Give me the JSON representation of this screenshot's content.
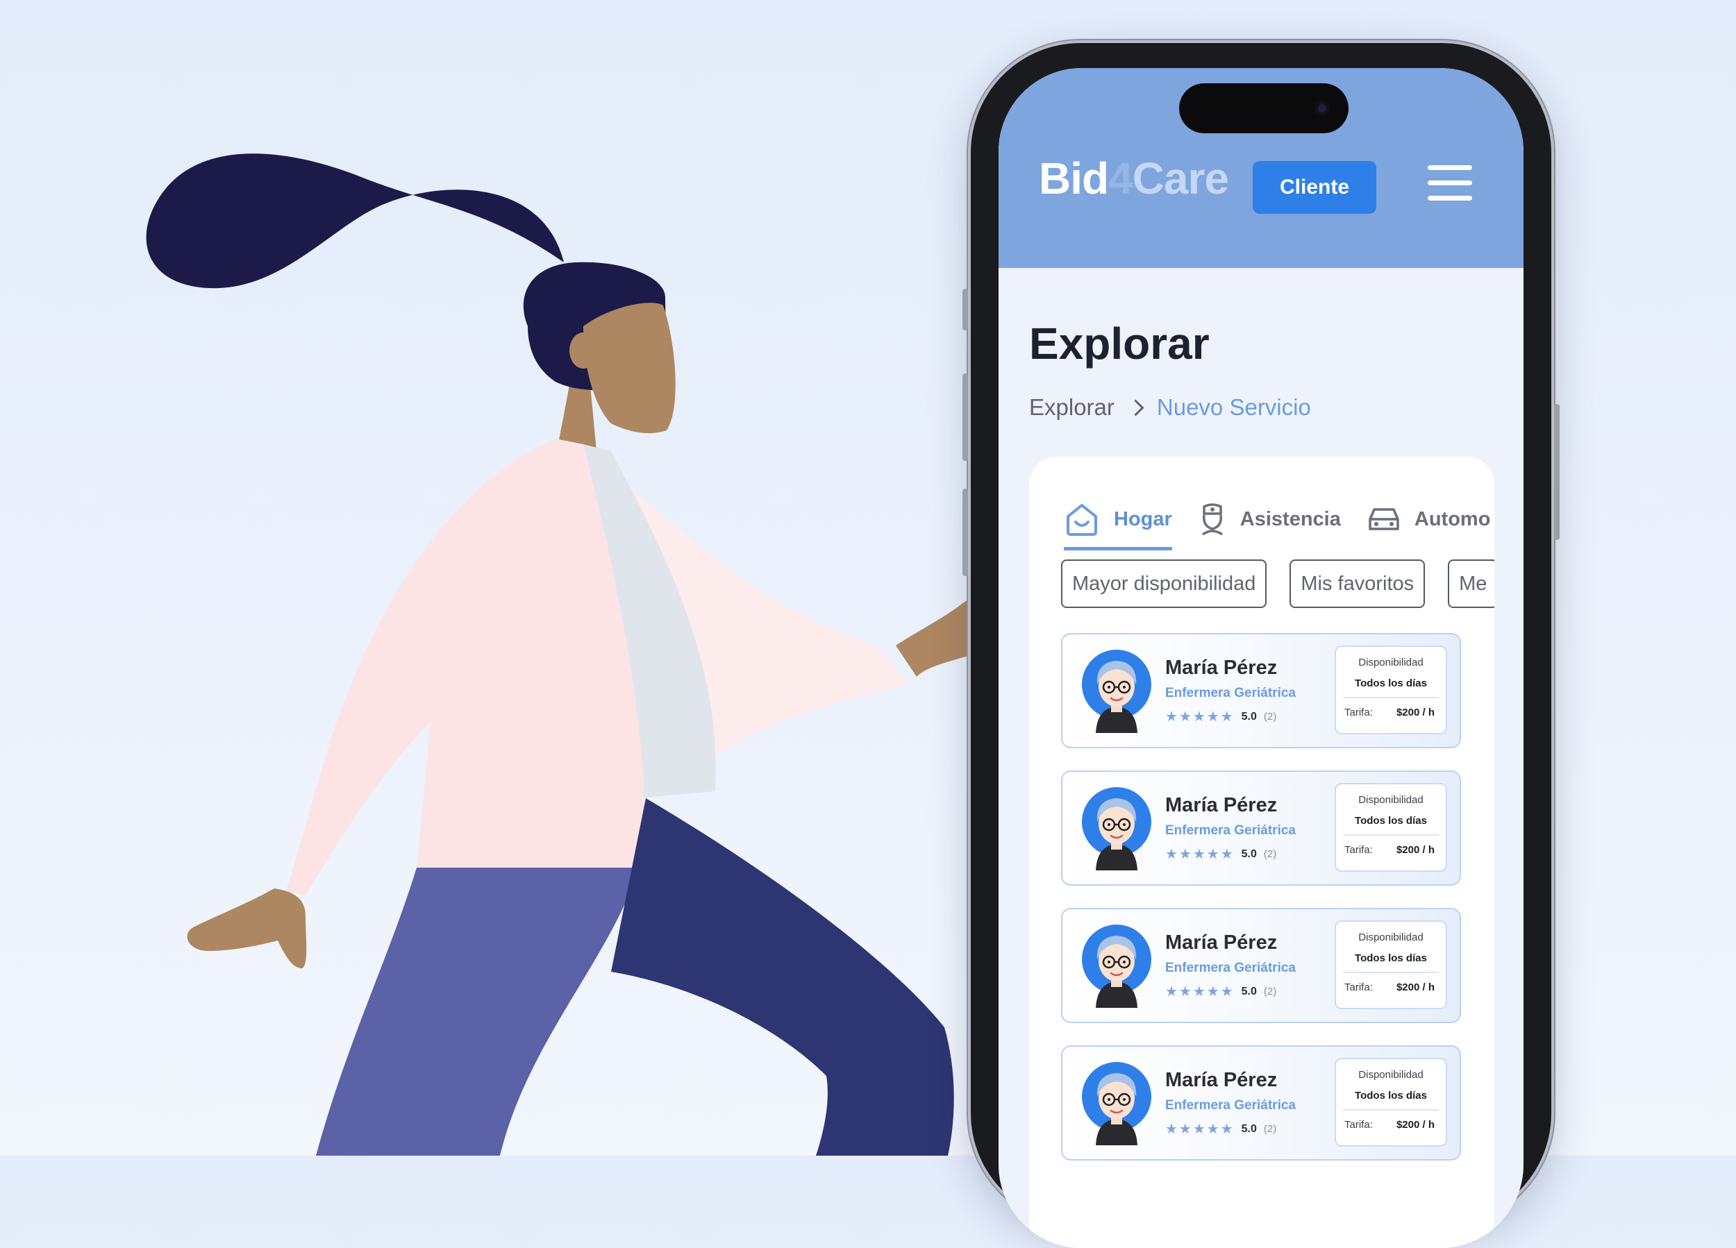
{
  "app": {
    "logo": {
      "part1": "Bid",
      "part2": "4",
      "part3": "Care"
    },
    "role_button": "Cliente",
    "menu_icon": "hamburger-menu-icon"
  },
  "page": {
    "title": "Explorar",
    "breadcrumb": [
      "Explorar",
      "Nuevo Servicio"
    ]
  },
  "tabs": [
    {
      "label": "Hogar",
      "icon": "home-icon",
      "active": true
    },
    {
      "label": "Asistencia",
      "icon": "nurse-icon",
      "active": false
    },
    {
      "label": "Automo",
      "icon": "car-icon",
      "active": false
    }
  ],
  "filters": [
    "Mayor disponibilidad",
    "Mis favoritos",
    "Me"
  ],
  "cards": [
    {
      "name": "María Pérez",
      "role": "Enfermera Geriátrica",
      "stars": "★★★★★",
      "rating": "5.0",
      "reviews": "(2)",
      "availability_label": "Disponibilidad",
      "availability": "Todos los días",
      "rate_label": "Tarifa:",
      "rate": "$200 / h"
    },
    {
      "name": "María Pérez",
      "role": "Enfermera Geriátrica",
      "stars": "★★★★★",
      "rating": "5.0",
      "reviews": "(2)",
      "availability_label": "Disponibilidad",
      "availability": "Todos los días",
      "rate_label": "Tarifa:",
      "rate": "$200 / h"
    },
    {
      "name": "María Pérez",
      "role": "Enfermera Geriátrica",
      "stars": "★★★★★",
      "rating": "5.0",
      "reviews": "(2)",
      "availability_label": "Disponibilidad",
      "availability": "Todos los días",
      "rate_label": "Tarifa:",
      "rate": "$200 / h"
    },
    {
      "name": "María Pérez",
      "role": "Enfermera Geriátrica",
      "stars": "★★★★★",
      "rating": "5.0",
      "reviews": "(2)",
      "availability_label": "Disponibilidad",
      "availability": "Todos los días",
      "rate_label": "Tarifa:",
      "rate": "$200 / h"
    }
  ],
  "colors": {
    "appbar": "#7ea5de",
    "primary_button": "#2f7fe8",
    "accent": "#6a9be0",
    "hair": "#1b1a48",
    "jacket": "#fde4e4",
    "pants_light": "#5b62a8",
    "pants_dark": "#2e3573",
    "skin": "#ad8761"
  }
}
